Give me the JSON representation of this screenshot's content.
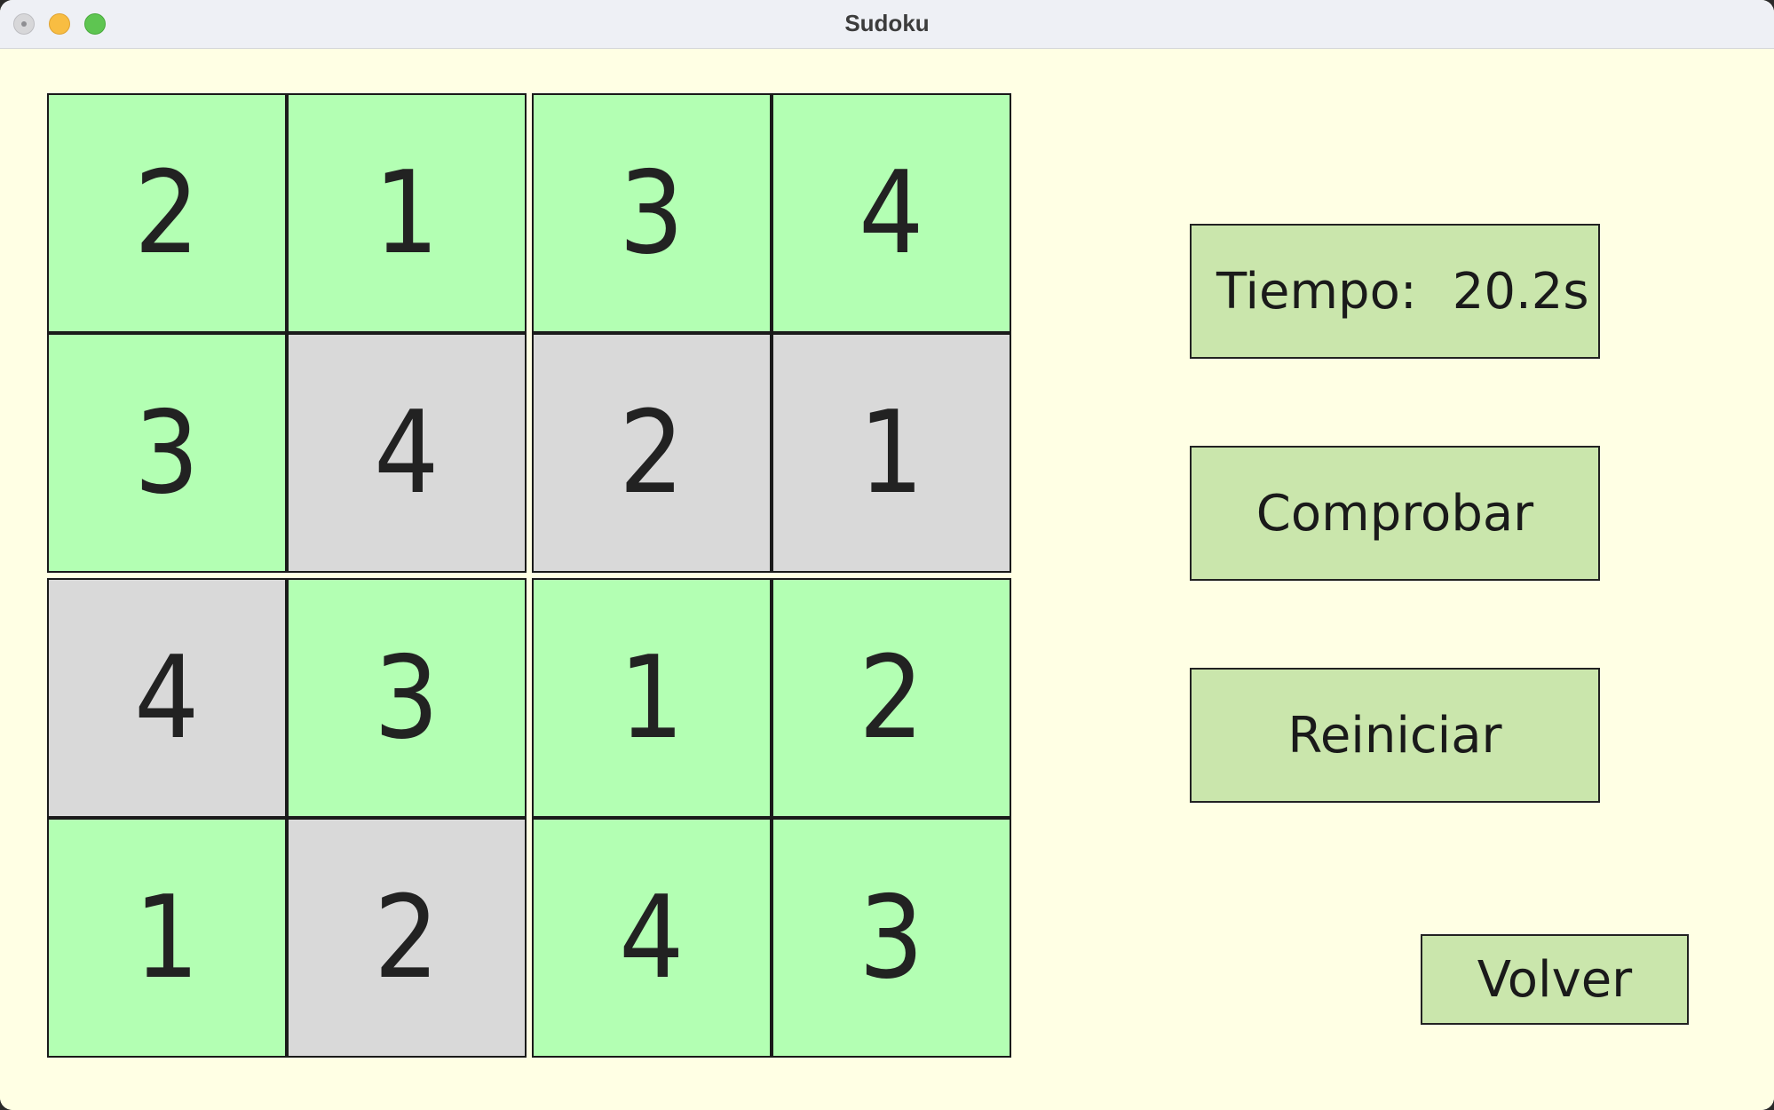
{
  "window": {
    "title": "Sudoku"
  },
  "board": {
    "rows": [
      [
        {
          "value": "2",
          "state": "ok"
        },
        {
          "value": "1",
          "state": "ok"
        },
        {
          "value": "3",
          "state": "ok"
        },
        {
          "value": "4",
          "state": "ok"
        }
      ],
      [
        {
          "value": "3",
          "state": "ok"
        },
        {
          "value": "4",
          "state": "empty"
        },
        {
          "value": "2",
          "state": "empty"
        },
        {
          "value": "1",
          "state": "empty"
        }
      ],
      [
        {
          "value": "4",
          "state": "empty"
        },
        {
          "value": "3",
          "state": "ok"
        },
        {
          "value": "1",
          "state": "ok"
        },
        {
          "value": "2",
          "state": "ok"
        }
      ],
      [
        {
          "value": "1",
          "state": "ok"
        },
        {
          "value": "2",
          "state": "empty"
        },
        {
          "value": "4",
          "state": "ok"
        },
        {
          "value": "3",
          "state": "ok"
        }
      ]
    ]
  },
  "timer": {
    "label": "Tiempo:",
    "value": "20.2s"
  },
  "buttons": {
    "check_label": "Comprobar",
    "reset_label": "Reiniciar",
    "back_label": "Volver"
  },
  "colors": {
    "cell_ok": "#b3ffb3",
    "cell_empty": "#d9d9d9",
    "button_bg": "#cae6ac",
    "background": "#ffffe4"
  }
}
